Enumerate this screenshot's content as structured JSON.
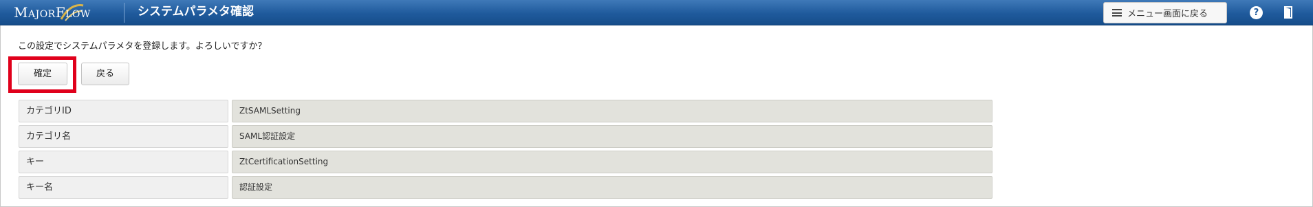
{
  "header": {
    "logo_text": "MajorFlow",
    "title": "システムパラメタ確認",
    "menu_button_label": "メニュー画面に戻る",
    "menu_icon": "hamburger-icon",
    "help_icon": "help-icon",
    "help_glyph": "?",
    "logout_icon": "logout-icon"
  },
  "main": {
    "message": "この設定でシステムパラメタを登録します。よろしいですか？",
    "confirm_label": "確定",
    "back_label": "戻る",
    "highlight_color": "#e0001b",
    "rows": [
      {
        "label": "カテゴリID",
        "value": "ZtSAMLSetting"
      },
      {
        "label": "カテゴリ名",
        "value": "SAML認証設定"
      },
      {
        "label": "キー",
        "value": "ZtCertificationSetting"
      },
      {
        "label": "キー名",
        "value": "認証設定"
      }
    ]
  },
  "colors": {
    "header_bg": "#1f5a9c",
    "label_cell_bg": "#f0f0f0",
    "value_cell_bg": "#e2e2dc"
  }
}
